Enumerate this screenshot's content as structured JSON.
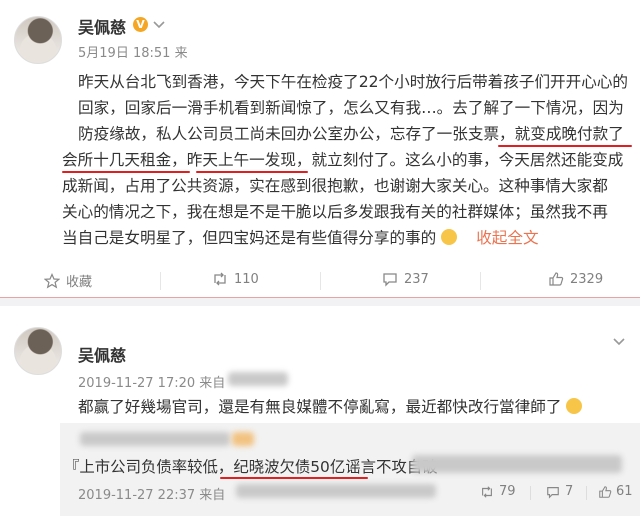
{
  "post1": {
    "author": "吴佩慈",
    "verified_badge": "V",
    "time": "5月19日 18:51",
    "source": "来",
    "lines": [
      "昨天从台北飞到香港，今天下午在检疫了22个小时放行后带着孩子们开开心心的",
      "回家，回家后一滑手机看到新闻惊了，怎么又有我…。去了解了一下情况，因为",
      "防疫缘故，私人公司员工尚未回办公室办公，忘存了一张支票，就变成晚付款了",
      "会所十几天租金，昨天上午一发现，就立刻付了。这么小的事，今天居然还能变成",
      "成新闻，占用了公共资源，实在感到很抱歉，也谢谢大家关心。这种事情大家都",
      "关心的情况之下，我在想是不是干脆以后多发跟我有关的社群媒体；虽然我不再",
      "当自己是女明星了，但四宝妈还是有些值得分享的事的"
    ],
    "collapse_label": "收起全文",
    "toolbar": {
      "favorite_label": "收藏",
      "repost_count": "110",
      "comment_count": "237",
      "like_count": "2329"
    }
  },
  "post2": {
    "author": "吴佩慈",
    "time": "2019-11-27 17:20",
    "source": "来自",
    "text": "都赢了好幾場官司，還是有無良媒體不停亂寫，最近都快改行當律師了",
    "quote": {
      "text_prefix": "『上市公司负债率较低，",
      "text_highlight": "纪晓波欠债50亿谣言不攻自破",
      "time": "2019-11-27 22:37",
      "source": "来自",
      "repost_count": "79",
      "comment_count": "7",
      "like_count": "61"
    }
  },
  "colors": {
    "accent": "#eb7350",
    "underline": "#e02020",
    "badge": "#f5a623"
  }
}
